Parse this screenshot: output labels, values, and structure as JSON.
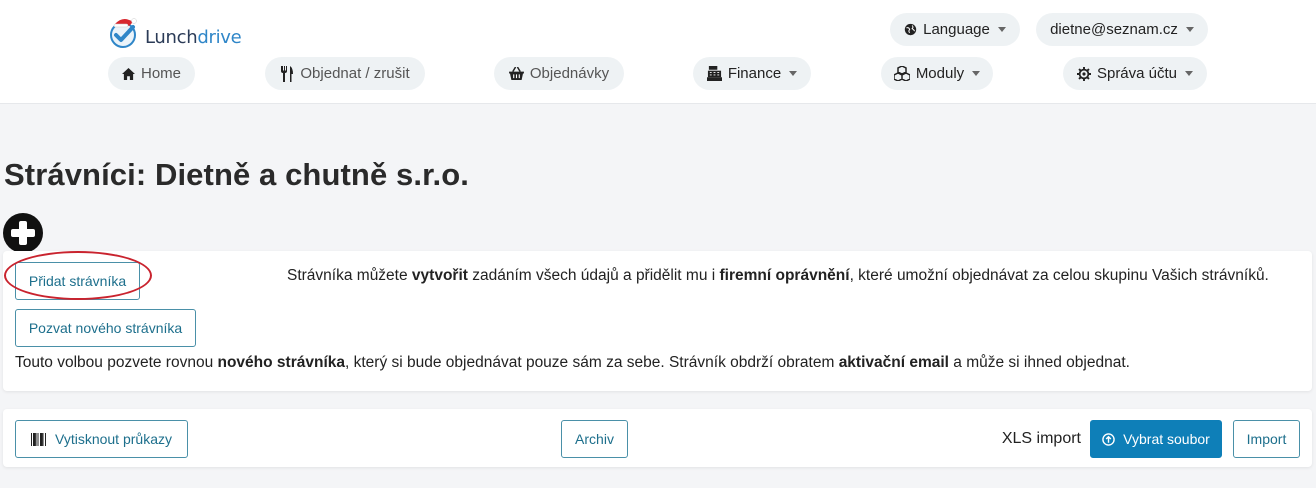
{
  "brand": {
    "name_main": "Lunch",
    "name_accent": "drive"
  },
  "header": {
    "language": "Language",
    "user_email": "dietne@seznam.cz"
  },
  "nav": {
    "home": "Home",
    "order": "Objednat / zrušit",
    "orders": "Objednávky",
    "finance": "Finance",
    "modules": "Moduly",
    "account": "Správa účtu"
  },
  "page": {
    "title": "Strávníci: Dietně a chutně s.r.o."
  },
  "add_section": {
    "add_button": "Přidat strávníka",
    "add_desc": {
      "p1": "Strávníka můžete ",
      "b1": "vytvořit",
      "p2": " zadáním všech údajů a přidělit mu i ",
      "b2": "firemní oprávnění",
      "p3": ", které umožní objednávat za celou skupinu Vašich strávníků."
    },
    "invite_button": "Pozvat nového strávníka",
    "invite_desc": {
      "p1": "Touto volbou pozvete rovnou ",
      "b1": "nového strávníka",
      "p2": ", který si bude objednávat pouze sám za sebe. Strávník obdrží obratem ",
      "b2": "aktivační email",
      "p3": " a může si ihned objednat."
    }
  },
  "toolbar": {
    "print_cards": "Vytisknout průkazy",
    "archive": "Archiv",
    "xls_label": "XLS import",
    "choose_file": "Vybrat soubor",
    "import": "Import"
  },
  "colors": {
    "primary": "#0e7fb8",
    "outline": "#4a90a8",
    "annotation": "#c9232e"
  }
}
